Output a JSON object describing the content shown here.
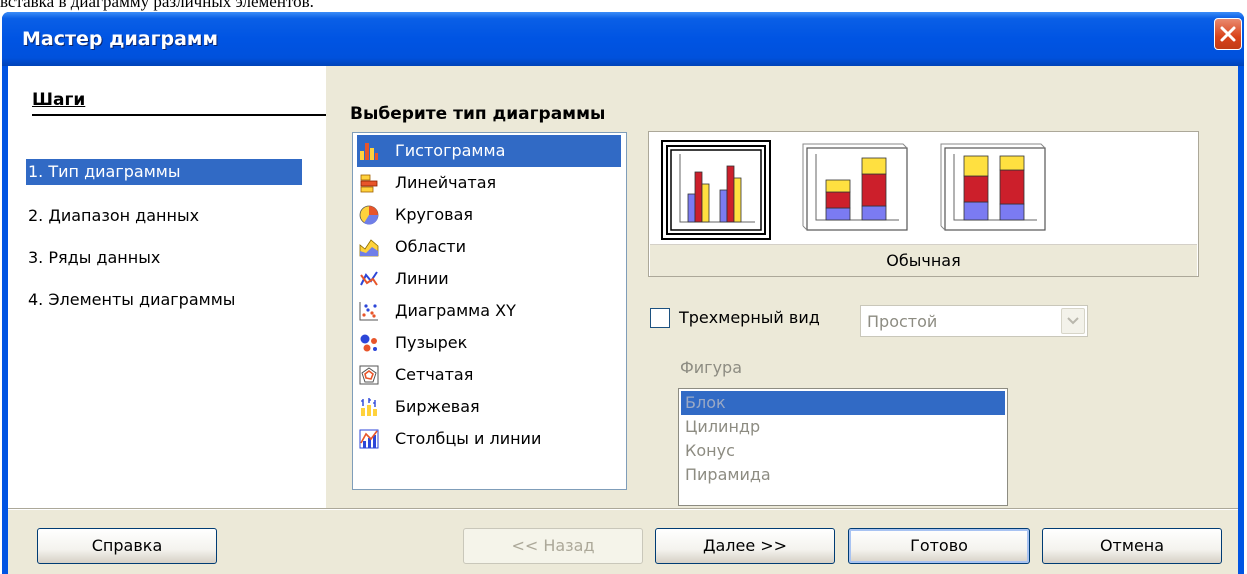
{
  "page": {
    "caption": "вставка в диаграмму различных элементов."
  },
  "window": {
    "title": "Мастер диаграмм",
    "close_icon": "close-icon"
  },
  "steps": {
    "heading": "Шаги",
    "items": [
      {
        "label": "1. Тип диаграммы",
        "selected": true
      },
      {
        "label": "2. Диапазон данных",
        "selected": false
      },
      {
        "label": "3. Ряды данных",
        "selected": false
      },
      {
        "label": "4. Элементы диаграммы",
        "selected": false
      }
    ]
  },
  "chart_type": {
    "heading": "Выберите тип диаграммы",
    "types": [
      {
        "label": "Гистограмма",
        "icon": "column-chart-icon",
        "selected": true
      },
      {
        "label": "Линейчатая",
        "icon": "bar-chart-icon",
        "selected": false
      },
      {
        "label": "Круговая",
        "icon": "pie-chart-icon",
        "selected": false
      },
      {
        "label": "Области",
        "icon": "area-chart-icon",
        "selected": false
      },
      {
        "label": "Линии",
        "icon": "line-chart-icon",
        "selected": false
      },
      {
        "label": "Диаграмма XY",
        "icon": "xy-scatter-icon",
        "selected": false
      },
      {
        "label": "Пузырек",
        "icon": "bubble-chart-icon",
        "selected": false
      },
      {
        "label": "Сетчатая",
        "icon": "net-chart-icon",
        "selected": false
      },
      {
        "label": "Биржевая",
        "icon": "stock-chart-icon",
        "selected": false
      },
      {
        "label": "Столбцы и линии",
        "icon": "column-line-chart-icon",
        "selected": false
      }
    ],
    "variants": [
      {
        "icon": "normal-column-variant-icon",
        "selected": true
      },
      {
        "icon": "stacked-column-variant-icon",
        "selected": false
      },
      {
        "icon": "percent-stacked-column-variant-icon",
        "selected": false
      }
    ],
    "variant_label": "Обычная",
    "three_d": {
      "label": "Трехмерный вид",
      "checked": false
    },
    "three_d_style": {
      "value": "Простой"
    },
    "shape": {
      "label": "Фигура",
      "options": [
        {
          "label": "Блок",
          "selected": true
        },
        {
          "label": "Цилиндр",
          "selected": false
        },
        {
          "label": "Конус",
          "selected": false
        },
        {
          "label": "Пирамида",
          "selected": false
        }
      ]
    }
  },
  "buttons": {
    "help": "Справка",
    "back": "<< Назад",
    "next": "Далее >>",
    "finish": "Готово",
    "cancel": "Отмена"
  },
  "colors": {
    "title_bar": "#0054e3",
    "selection": "#316ac5",
    "dialog_bg": "#ece9d8",
    "bar_blue": "#7b7bf2",
    "bar_red": "#cc1f2b",
    "bar_yellow": "#ffe040"
  }
}
